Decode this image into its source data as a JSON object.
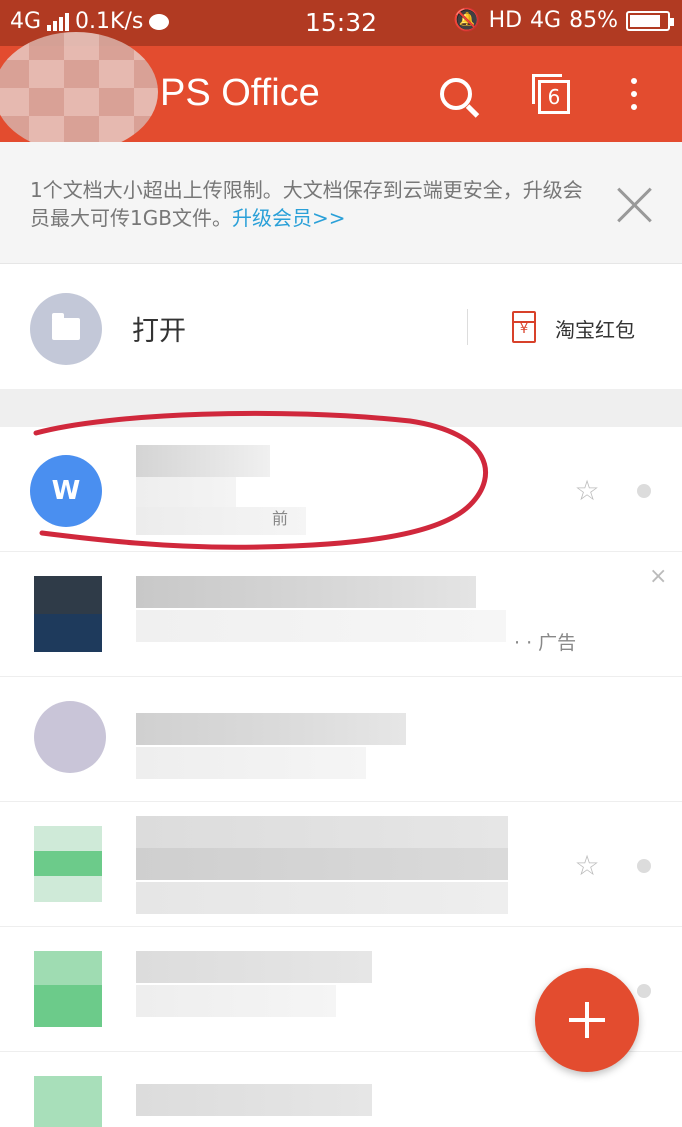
{
  "status_bar": {
    "network": "4G",
    "speed": "0.1K/s",
    "time": "15:32",
    "hd": "HD",
    "net_type": "4G",
    "battery": "85%",
    "battery_level": 0.85
  },
  "app_bar": {
    "title": "PS Office",
    "tab_count": "6"
  },
  "notice": {
    "text": "1个文档大小超出上传限制。大文档保存到云端更安全，升级会员最大可传1GB文件。",
    "link": "升级会员>>"
  },
  "open_row": {
    "label": "打开",
    "taobao_label": "淘宝红包"
  },
  "files": [
    {
      "type_letter": "W",
      "meta": "前"
    }
  ],
  "ad": {
    "label": "· · 广告",
    "close": "×"
  },
  "colors": {
    "status_bar": "#b13a22",
    "app_bar": "#e34c2f",
    "link": "#2aa0d8",
    "annotation": "#d0283c",
    "word_icon": "#4a8ff0"
  },
  "icons": {
    "search": "search-icon",
    "tabs": "tabs-icon",
    "more": "more-vert-icon",
    "close": "close-icon",
    "folder": "folder-icon",
    "taobao": "red-packet-icon",
    "star": "star-icon",
    "add": "plus-icon"
  }
}
